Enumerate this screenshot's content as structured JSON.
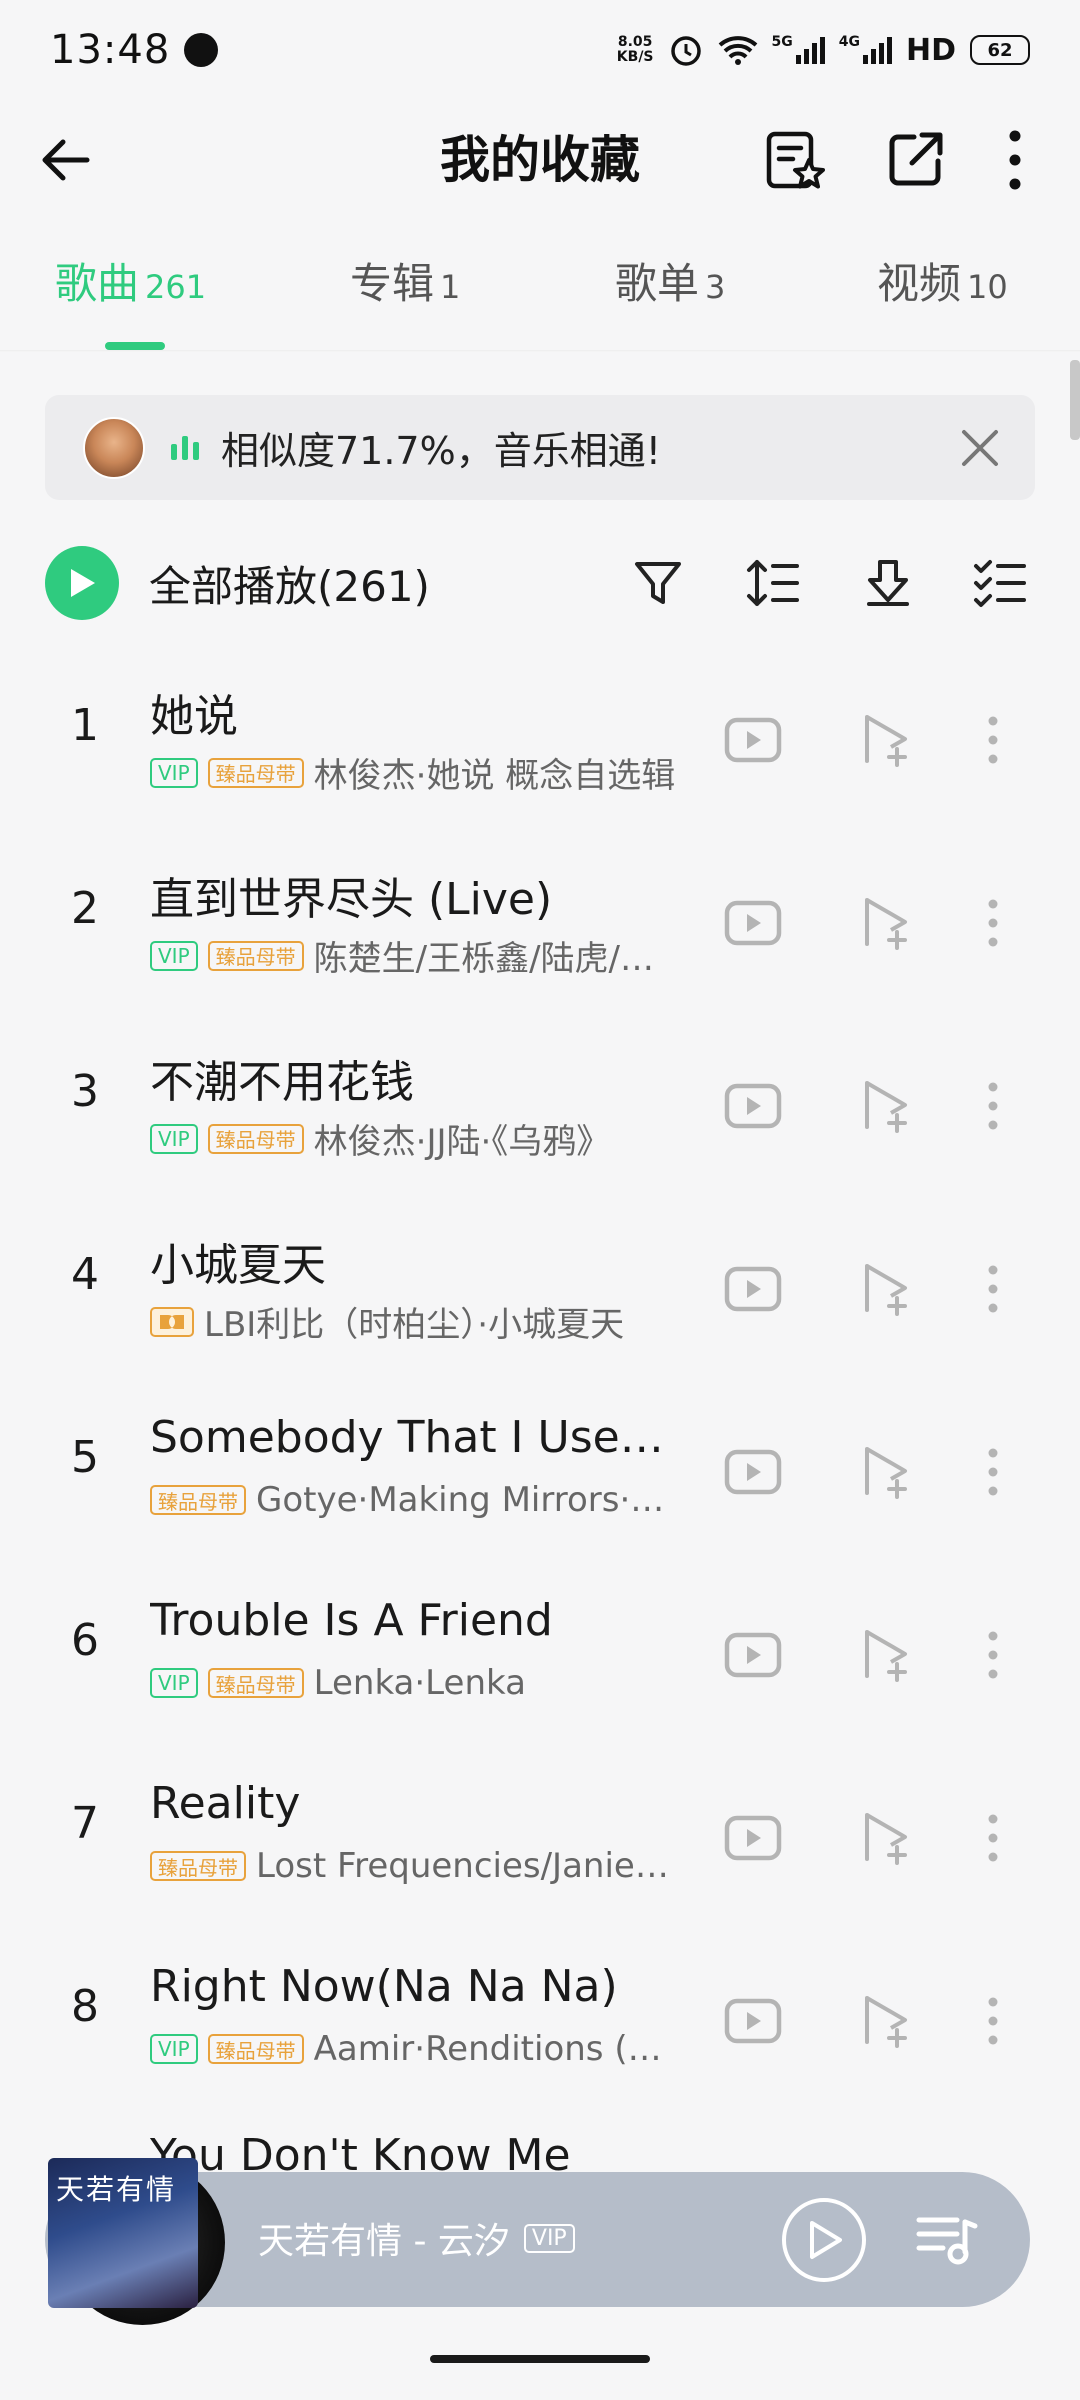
{
  "status_bar": {
    "time": "13:48",
    "net_speed_top": "8.05",
    "net_speed_bottom": "KB/S",
    "signal_5g": "5G",
    "signal_4g": "4G",
    "hd": "HD",
    "battery": "62"
  },
  "header": {
    "title": "我的收藏",
    "icons": [
      "back-arrow-icon",
      "favorite-list-icon",
      "share-icon",
      "more-vertical-icon"
    ]
  },
  "tabs": [
    {
      "label": "歌曲",
      "count": "261",
      "active": true
    },
    {
      "label": "专辑",
      "count": "1",
      "active": false
    },
    {
      "label": "歌单",
      "count": "3",
      "active": false
    },
    {
      "label": "视频",
      "count": "10",
      "active": false
    }
  ],
  "banner": {
    "text": "相似度71.7%，音乐相通!"
  },
  "play_all": {
    "label": "全部播放(261)"
  },
  "songs": [
    {
      "index": "1",
      "title": "她说",
      "badges": [
        "vip",
        "gold"
      ],
      "vip_text": "VIP",
      "gold_text": "臻品母带",
      "artist": "林俊杰·她说 概念自选辑"
    },
    {
      "index": "2",
      "title": "直到世界尽头 (Live)",
      "badges": [
        "vip",
        "gold"
      ],
      "vip_text": "VIP",
      "gold_text": "臻品母带",
      "artist": "陈楚生/王栎鑫/陆虎/张远"
    },
    {
      "index": "3",
      "title": "不潮不用花钱",
      "badges": [
        "vip",
        "gold"
      ],
      "vip_text": "VIP",
      "gold_text": "臻品母带",
      "artist": "林俊杰·JJ陆·《乌鸦》"
    },
    {
      "index": "4",
      "title": "小城夏天",
      "badges": [
        "dolby"
      ],
      "artist": "LBI利比（时柏尘）·小城夏天"
    },
    {
      "index": "5",
      "title": "Somebody That I Used To Know",
      "badges": [
        "gold"
      ],
      "gold_text": "臻品母带",
      "artist": "Gotye·Making Mirrors·Deluxe"
    },
    {
      "index": "6",
      "title": "Trouble Is A Friend",
      "badges": [
        "vip",
        "gold"
      ],
      "vip_text": "VIP",
      "gold_text": "臻品母带",
      "artist": "Lenka·Lenka"
    },
    {
      "index": "7",
      "title": "Reality",
      "badges": [
        "gold"
      ],
      "gold_text": "臻品母带",
      "artist": "Lost Frequencies/Janieck Devy"
    },
    {
      "index": "8",
      "title": "Right Now(Na Na Na)",
      "badges": [
        "vip",
        "gold"
      ],
      "vip_text": "VIP",
      "gold_text": "臻品母带",
      "artist": "Aamir·Renditions (Remix)"
    }
  ],
  "mini_player": {
    "cover_text": "天若有情",
    "title": "天若有情 - 云汐",
    "vip": "VIP",
    "peek_title": "You Don't Know Me"
  },
  "colors": {
    "accent": "#2fcb7f",
    "gold_badge": "#e8a23c",
    "background": "#f6f6f7",
    "mini_player_bg": "#b5bdc9"
  }
}
